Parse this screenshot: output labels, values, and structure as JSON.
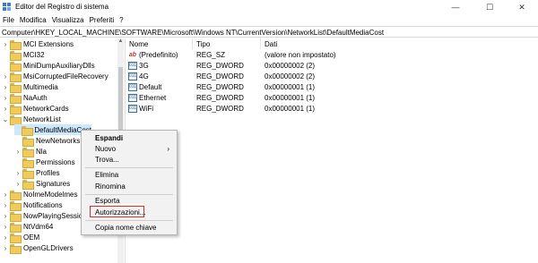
{
  "window": {
    "title": "Editor del Registro di sistema",
    "minimize_glyph": "—",
    "maximize_glyph": "☐",
    "close_glyph": "✕"
  },
  "menu": [
    "File",
    "Modifica",
    "Visualizza",
    "Preferiti",
    "?"
  ],
  "address": "Computer\\HKEY_LOCAL_MACHINE\\SOFTWARE\\Microsoft\\Windows NT\\CurrentVersion\\NetworkList\\DefaultMediaCost",
  "tree": {
    "items": [
      {
        "label": "MCI Extensions",
        "chevron": "›",
        "level": 0
      },
      {
        "label": "MCI32",
        "chevron": "",
        "level": 0
      },
      {
        "label": "MiniDumpAuxiliaryDlls",
        "chevron": "",
        "level": 0
      },
      {
        "label": "MsiCorruptedFileRecovery",
        "chevron": "›",
        "level": 0
      },
      {
        "label": "Multimedia",
        "chevron": "›",
        "level": 0
      },
      {
        "label": "NaAuth",
        "chevron": "›",
        "level": 0
      },
      {
        "label": "NetworkCards",
        "chevron": "›",
        "level": 0
      },
      {
        "label": "NetworkList",
        "chevron": "⌄",
        "level": 0
      },
      {
        "label": "DefaultMediaCost",
        "chevron": "",
        "level": 1,
        "selected": true
      },
      {
        "label": "NewNetworks",
        "chevron": "",
        "level": 1
      },
      {
        "label": "Nla",
        "chevron": "›",
        "level": 1
      },
      {
        "label": "Permissions",
        "chevron": "",
        "level": 1
      },
      {
        "label": "Profiles",
        "chevron": "›",
        "level": 1
      },
      {
        "label": "Signatures",
        "chevron": "›",
        "level": 1
      },
      {
        "label": "NoImeModelmes",
        "chevron": "›",
        "level": 0
      },
      {
        "label": "Notifications",
        "chevron": "›",
        "level": 0
      },
      {
        "label": "NowPlayingSessio",
        "chevron": "›",
        "level": 0
      },
      {
        "label": "NtVdm64",
        "chevron": "›",
        "level": 0
      },
      {
        "label": "OEM",
        "chevron": "›",
        "level": 0
      },
      {
        "label": "OpenGLDrivers",
        "chevron": "›",
        "level": 0
      }
    ]
  },
  "list": {
    "columns": [
      "Nome",
      "Tipo",
      "Dati"
    ],
    "rows": [
      {
        "icon": "string-value-icon",
        "glyph": "ab",
        "name": "(Predefinito)",
        "type": "REG_SZ",
        "data": "(valore non impostato)"
      },
      {
        "icon": "binary-value-icon",
        "glyph": "011",
        "name": "3G",
        "type": "REG_DWORD",
        "data": "0x00000002 (2)"
      },
      {
        "icon": "binary-value-icon",
        "glyph": "011",
        "name": "4G",
        "type": "REG_DWORD",
        "data": "0x00000002 (2)"
      },
      {
        "icon": "binary-value-icon",
        "glyph": "011",
        "name": "Default",
        "type": "REG_DWORD",
        "data": "0x00000001 (1)"
      },
      {
        "icon": "binary-value-icon",
        "glyph": "011",
        "name": "Ethernet",
        "type": "REG_DWORD",
        "data": "0x00000001 (1)"
      },
      {
        "icon": "binary-value-icon",
        "glyph": "011",
        "name": "WiFi",
        "type": "REG_DWORD",
        "data": "0x00000001 (1)"
      }
    ]
  },
  "context_menu": {
    "expand": "Espandi",
    "new": "Nuovo",
    "new_arrow": "›",
    "find": "Trova...",
    "delete": "Elimina",
    "rename": "Rinomina",
    "export": "Esporta",
    "permissions": "Autorizzazioni...",
    "copy_key_name": "Copia nome chiave"
  },
  "colors": {
    "highlight_border": "#d9302c",
    "selected_row": "#cce8ff",
    "folder": "#f1cb5a"
  }
}
